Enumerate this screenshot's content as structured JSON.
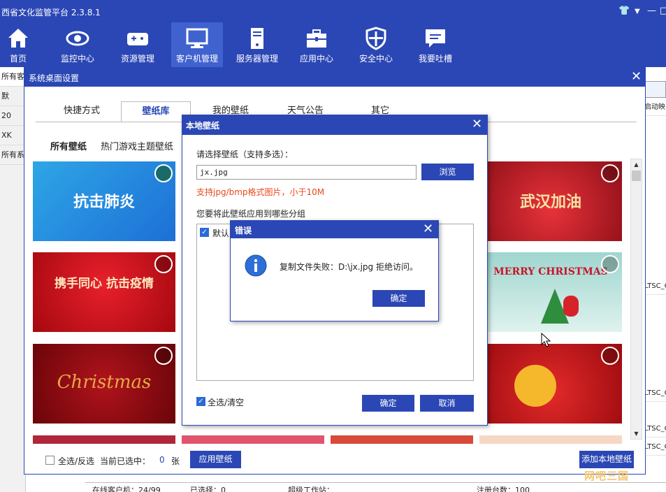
{
  "app": {
    "title": "西省文化监管平台 2.3.8.1"
  },
  "window_controls": {
    "skin": "👕",
    "menu": "▼",
    "minimize": "—",
    "close": "□"
  },
  "toolbar": [
    {
      "label": "首页",
      "icon": "home-icon"
    },
    {
      "label": "监控中心",
      "icon": "eye-icon"
    },
    {
      "label": "资源管理",
      "icon": "gamepad-icon"
    },
    {
      "label": "客户机管理",
      "icon": "monitor-icon",
      "active": true
    },
    {
      "label": "服务器管理",
      "icon": "server-icon"
    },
    {
      "label": "应用中心",
      "icon": "toolbox-icon"
    },
    {
      "label": "安全中心",
      "icon": "shield-icon"
    },
    {
      "label": "我要吐槽",
      "icon": "chat-icon"
    }
  ],
  "background": {
    "left_items": [
      "所有客",
      "默",
      "20",
      "XK",
      "所有系"
    ],
    "right_header": "启动映",
    "right_items": [
      "LTSC_C",
      "LTSC_C",
      "LTSC_C",
      "LTSC_C"
    ],
    "status": [
      "在线客户机：24/99",
      "已选择：0",
      "超级工作站：",
      "注册台数：100"
    ]
  },
  "main_dialog": {
    "title": "系统桌面设置",
    "close": "✕",
    "tabs": [
      "快捷方式",
      "壁纸库",
      "我的壁纸",
      "天气公告",
      "其它"
    ],
    "subtabs": [
      "所有壁纸",
      "热门游戏主题壁纸"
    ],
    "cards": [
      "抗击肺炎",
      "武汉加油",
      "携手同心 抗击疫情",
      "MERRY CHRISTMAS",
      "Christmas",
      ""
    ],
    "footer": {
      "select_all": "全选/反选",
      "selected_label": "当前已选中：",
      "selected_count": "0",
      "unit": "张",
      "apply": "应用壁纸",
      "add_local": "添加本地壁纸"
    }
  },
  "local_dialog": {
    "title": "本地壁纸",
    "close": "✕",
    "prompt": "请选择壁纸（支持多选）：",
    "file_value": "jx.jpg",
    "browse": "浏览",
    "hint": "支持jpg/bmp格式图片，小于10M",
    "group_prompt": "您要将此壁纸应用到哪些分组",
    "group_item": "默认",
    "select_all": "全选/清空",
    "ok": "确定",
    "cancel": "取消"
  },
  "error_dialog": {
    "title": "错误",
    "close": "✕",
    "message": "复制文件失败：D:\\jx.jpg 拒绝访问。",
    "ok": "确定"
  },
  "watermark": "网吧三国",
  "colors": {
    "accent": "#2b47b5",
    "hint": "#e8491b"
  }
}
